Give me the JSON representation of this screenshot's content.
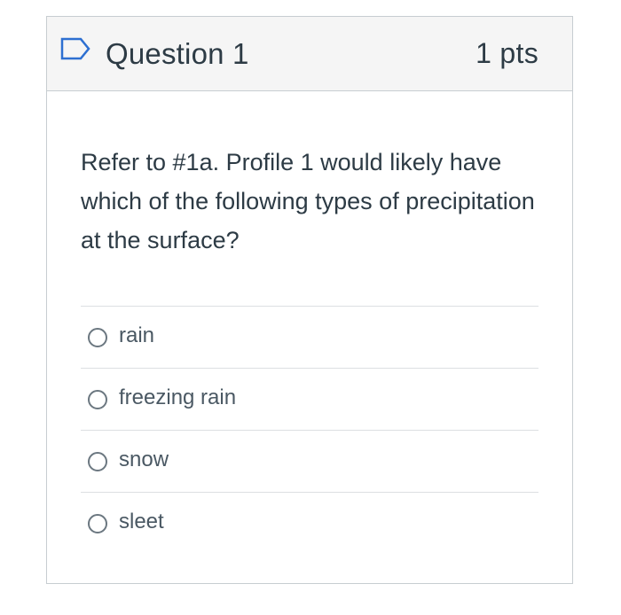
{
  "question": {
    "title": "Question 1",
    "points": "1 pts",
    "text": "Refer to #1a. Profile 1 would likely have which of the following types of precipitation at the surface?",
    "header_icon": "flag-icon"
  },
  "answers": [
    {
      "label": "rain",
      "selected": false
    },
    {
      "label": "freezing rain",
      "selected": false
    },
    {
      "label": "snow",
      "selected": false
    },
    {
      "label": "sleet",
      "selected": false
    }
  ],
  "colors": {
    "header_background": "#f5f5f5",
    "border": "#c7cdd1",
    "text": "#2d3b45",
    "flag_icon": "#2d6fd1"
  }
}
